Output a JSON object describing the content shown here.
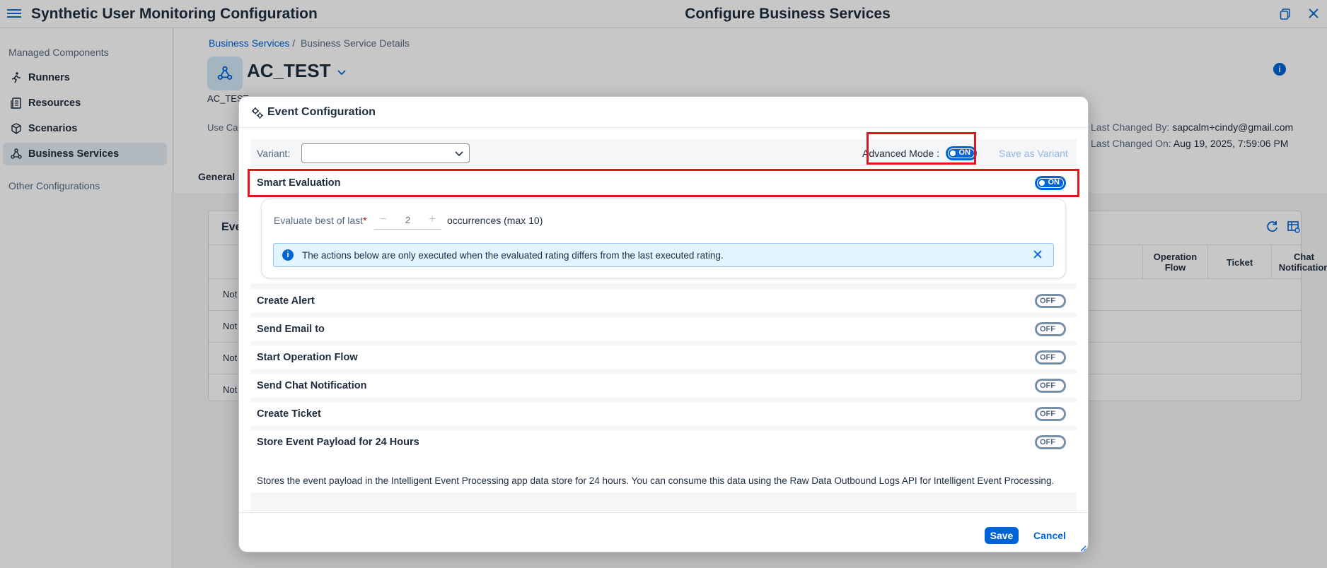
{
  "shell": {
    "app_title": "Synthetic User Monitoring Configuration",
    "page_title": "Configure Business Services"
  },
  "sidebar": {
    "group1": "Managed Components",
    "items": [
      {
        "label": "Runners",
        "icon": "runner-icon"
      },
      {
        "label": "Resources",
        "icon": "resources-icon"
      },
      {
        "label": "Scenarios",
        "icon": "scenarios-icon"
      },
      {
        "label": "Business Services",
        "icon": "business-services-icon"
      }
    ],
    "group2": "Other Configurations"
  },
  "page": {
    "breadcrumb_link": "Business Services",
    "breadcrumb_sep": "/",
    "breadcrumb_current": "Business Service Details",
    "object_title": "AC_TEST",
    "object_subtitle": "AC_TEST",
    "use_case_label": "Use Ca",
    "last_changed_by_label": "Last Changed By:",
    "last_changed_by": "sapcalm+cindy@gmail.com",
    "last_changed_on_label": "Last Changed On:",
    "last_changed_on": "Aug 19, 2025, 7:59:06 PM",
    "tab_general": "General",
    "panel_title": "Eve",
    "table_headers": [
      "Operation Flow",
      "Ticket",
      "Chat Notification"
    ],
    "rows": [
      "Not",
      "Not",
      "Not",
      "Not"
    ]
  },
  "dialog": {
    "title": "Event Configuration",
    "variant_label": "Variant:",
    "variant_value": "",
    "advanced_mode_label": "Advanced Mode :",
    "advanced_mode": "ON",
    "save_as_variant": "Save as Variant",
    "smart_evaluation": {
      "label": "Smart Evaluation",
      "state": "ON"
    },
    "evaluate_label": "Evaluate best of last",
    "required_mark": "*",
    "evaluate_value": "2",
    "stepper_minus": "−",
    "stepper_plus": "+",
    "occurrences_label": "occurrences (max 10)",
    "info_message": "The actions below are only executed when the evaluated rating differs from the last executed rating.",
    "actions": [
      {
        "label": "Create Alert",
        "state": "OFF"
      },
      {
        "label": "Send Email to",
        "state": "OFF"
      },
      {
        "label": "Start Operation Flow",
        "state": "OFF"
      },
      {
        "label": "Send Chat Notification",
        "state": "OFF"
      },
      {
        "label": "Create Ticket",
        "state": "OFF"
      },
      {
        "label": "Store Event Payload for 24 Hours",
        "state": "OFF"
      }
    ],
    "store_description": "Stores the event payload in the Intelligent Event Processing app data store for 24 hours. You can consume this data using the Raw Data Outbound Logs API for Intelligent Event Processing.",
    "save_button": "Save",
    "cancel_button": "Cancel"
  },
  "colors": {
    "brand": "#0064d9",
    "highlight": "#e3151a",
    "toggle_off": "#788fa6"
  }
}
